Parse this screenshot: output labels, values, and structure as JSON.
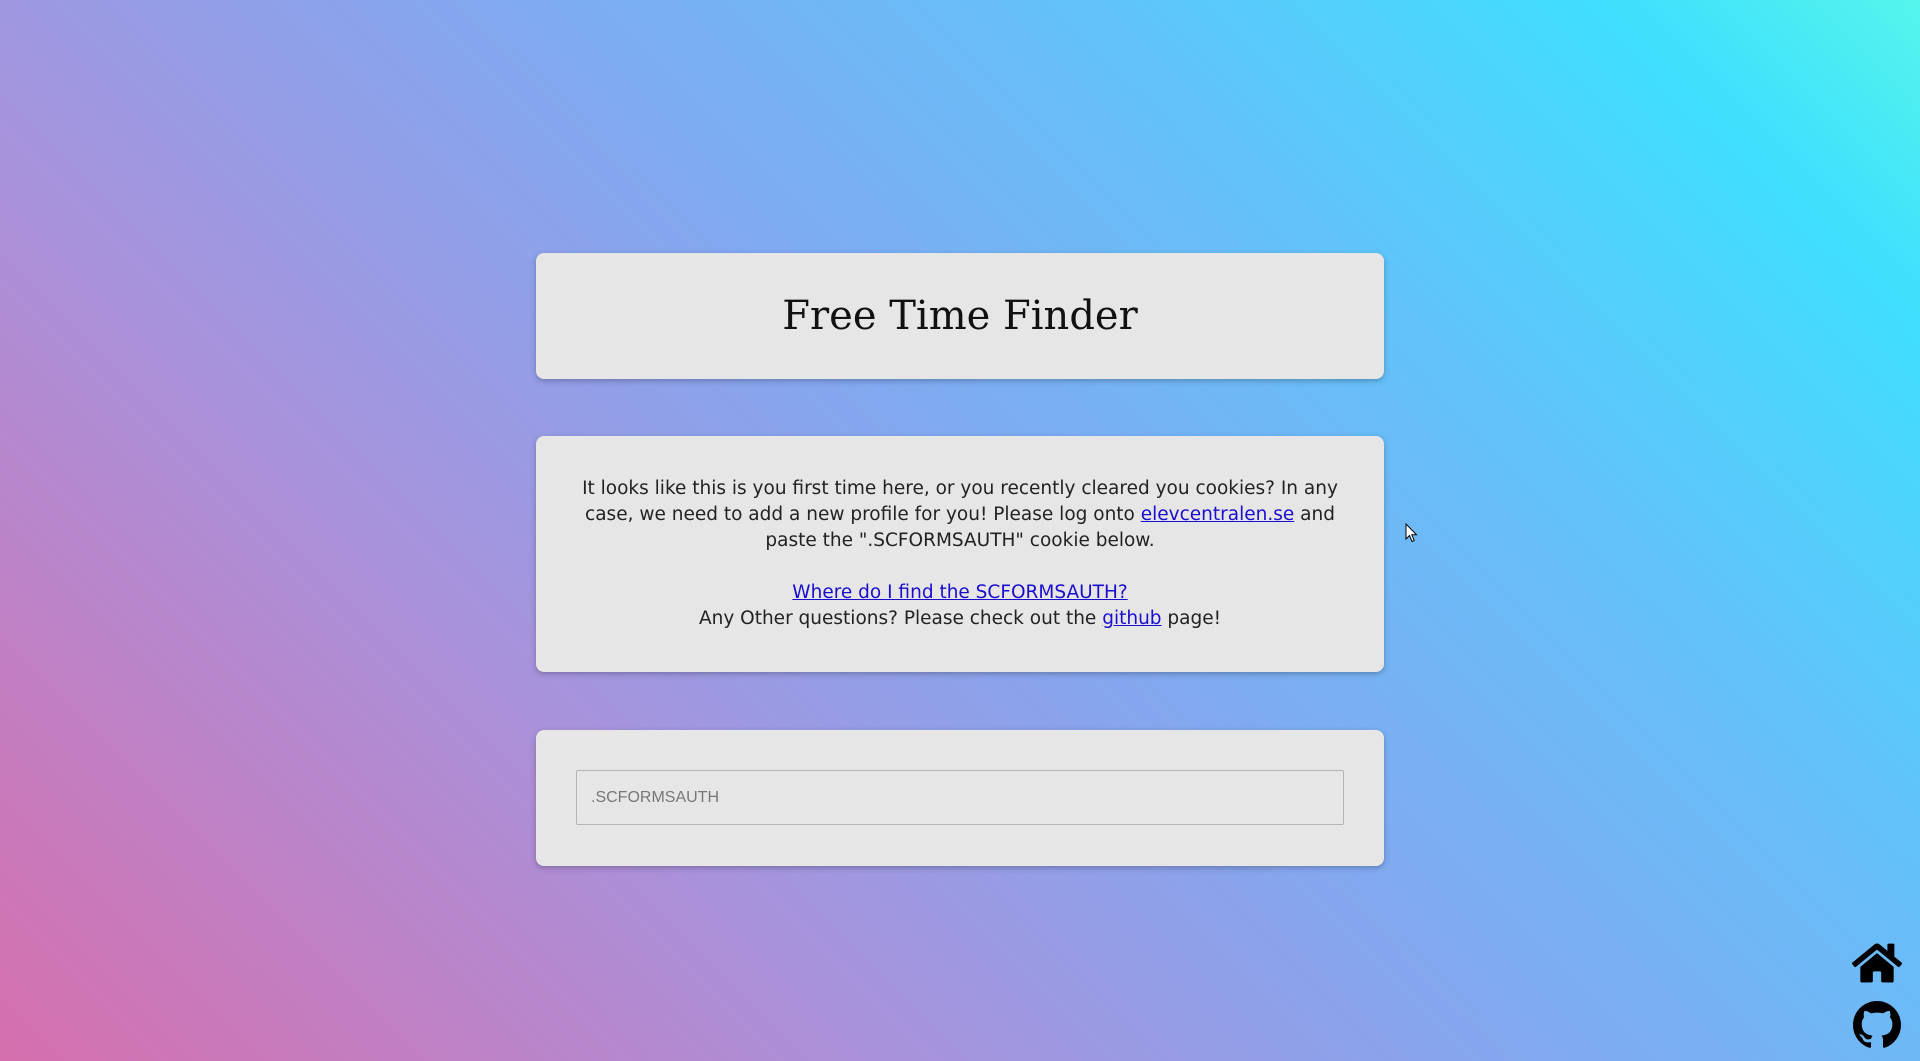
{
  "header": {
    "title": "Free Time Finder"
  },
  "info": {
    "text_before_link": "It looks like this is you first time here, or you recently cleared you cookies? In any case, we need to add a new profile for you! Please log onto ",
    "elevcentralen_link": "elevcentralen.se",
    "text_after_link": " and paste the \".SCFORMSAUTH\" cookie below.",
    "help_link": "Where do I find the SCFORMSAUTH?",
    "questions_before": "Any Other questions? Please check out the ",
    "github_link": "github",
    "questions_after": " page!"
  },
  "form": {
    "cookie_placeholder": ".SCFORMSAUTH",
    "cookie_value": ""
  },
  "corner": {
    "home_icon": "home-icon",
    "github_icon": "github-icon"
  },
  "colors": {
    "card_bg": "#e6e6e6",
    "link": "#1a0dce",
    "gradient_start": "#d66fad",
    "gradient_end": "#55f5ec"
  }
}
